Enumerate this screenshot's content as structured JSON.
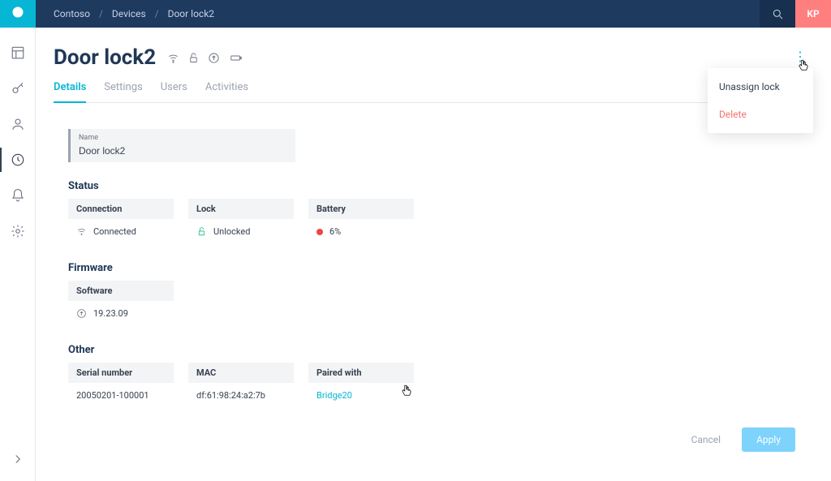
{
  "breadcrumb": {
    "org": "Contoso",
    "section": "Devices",
    "item": "Door lock2"
  },
  "avatar": "KP",
  "page": {
    "title": "Door lock2"
  },
  "tabs": {
    "details": "Details",
    "settings": "Settings",
    "users": "Users",
    "activities": "Activities",
    "active": "details"
  },
  "name_field": {
    "label": "Name",
    "value": "Door lock2"
  },
  "sections": {
    "status": {
      "title": "Status",
      "connection": {
        "label": "Connection",
        "value": "Connected"
      },
      "lock": {
        "label": "Lock",
        "value": "Unlocked"
      },
      "battery": {
        "label": "Battery",
        "value": "6%"
      }
    },
    "firmware": {
      "title": "Firmware",
      "software": {
        "label": "Software",
        "value": "19.23.09"
      }
    },
    "other": {
      "title": "Other",
      "serial": {
        "label": "Serial number",
        "value": "20050201-100001"
      },
      "mac": {
        "label": "MAC",
        "value": "df:61:98:24:a2:7b"
      },
      "paired": {
        "label": "Paired with",
        "value": "Bridge20"
      }
    }
  },
  "actions": {
    "cancel": "Cancel",
    "apply": "Apply"
  },
  "context_menu": {
    "unassign": "Unassign lock",
    "delete": "Delete"
  },
  "colors": {
    "accent": "#06b6d4",
    "danger": "#f87171",
    "header": "#1e3a5f",
    "logo_bg": "#06b6d4",
    "avatar_bg": "#ff7f7f"
  }
}
